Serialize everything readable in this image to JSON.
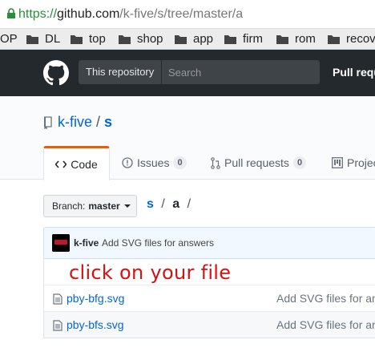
{
  "browser": {
    "url_scheme": "https://",
    "url_host": "github.com",
    "url_path": "/k-five/s/tree/master/a",
    "bookmarks": [
      "OP",
      "DL",
      "top",
      "shop",
      "app",
      "firm",
      "rom",
      "recov"
    ]
  },
  "header": {
    "search_scope": "This repository",
    "search_placeholder": "Search",
    "nav_pull": "Pull requ"
  },
  "repo": {
    "owner": "k-five",
    "separator": "/",
    "name": "s"
  },
  "tabs": [
    {
      "label": "Code",
      "icon": "code-icon"
    },
    {
      "label": "Issues",
      "count": "0",
      "icon": "issue-icon"
    },
    {
      "label": "Pull requests",
      "count": "0",
      "icon": "pull-request-icon"
    },
    {
      "label": "Projec",
      "icon": "project-icon"
    }
  ],
  "branch": {
    "label": "Branch:",
    "value": "master"
  },
  "breadcrumb": {
    "root": "s",
    "sep": "/",
    "current": "a",
    "trail": "/"
  },
  "commit": {
    "author": "k-five",
    "message": "Add SVG files for answers"
  },
  "annotation": "click on your file",
  "files": [
    {
      "name": "pby-bfg.svg",
      "message": "Add SVG files for an"
    },
    {
      "name": "pby-bfs.svg",
      "message": "Add SVG files for an"
    }
  ],
  "colors": {
    "accent": "#e36209",
    "link": "#0366d6",
    "annotation": "#d31212"
  }
}
